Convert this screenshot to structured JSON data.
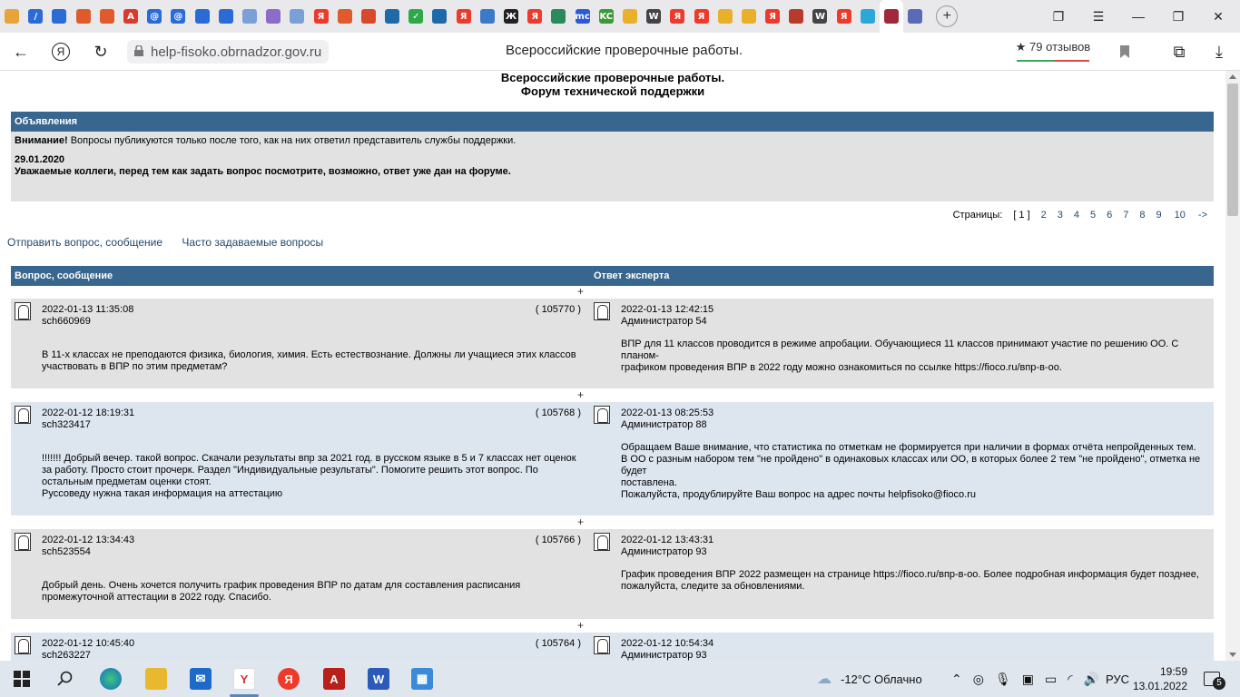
{
  "browser": {
    "tabs": [
      {
        "icon": "mail-icon",
        "color": "#e8a33a"
      },
      {
        "icon": "slash-icon",
        "color": "#2b6bd6"
      },
      {
        "icon": "mail-icon",
        "color": "#2b6bd6"
      },
      {
        "icon": "wheel-icon",
        "color": "#e05a2b"
      },
      {
        "icon": "wheel-icon",
        "color": "#e05a2b"
      },
      {
        "icon": "pdf-icon",
        "color": "#d83b2b"
      },
      {
        "icon": "at-icon",
        "color": "#2b6bd6"
      },
      {
        "icon": "at-icon",
        "color": "#2b6bd6"
      },
      {
        "icon": "mail-x-icon",
        "color": "#2b6bd6"
      },
      {
        "icon": "mail-x-icon",
        "color": "#2b6bd6"
      },
      {
        "icon": "dots-icon",
        "color": "#7aa0d8"
      },
      {
        "icon": "dots-icon",
        "color": "#8c6cc8"
      },
      {
        "icon": "dots-icon",
        "color": "#7aa0d8"
      },
      {
        "icon": "yandex-icon",
        "color": "#ee3a2b"
      },
      {
        "icon": "wheel-icon",
        "color": "#e05a2b"
      },
      {
        "icon": "box-icon",
        "color": "#d8492b"
      },
      {
        "icon": "book-icon",
        "color": "#1e6aa8"
      },
      {
        "icon": "check-icon",
        "color": "#2fa84a"
      },
      {
        "icon": "book-icon",
        "color": "#1e6aa8"
      },
      {
        "icon": "yandex-icon",
        "color": "#ee3a2b"
      },
      {
        "icon": "star-icon",
        "color": "#3a7ac8"
      },
      {
        "icon": "cross-icon",
        "color": "#222222"
      },
      {
        "icon": "yandex-icon",
        "color": "#ee3a2b"
      },
      {
        "icon": "globe-icon",
        "color": "#2b8a5a"
      },
      {
        "icon": "mc-icon",
        "color": "#2b5ad6"
      },
      {
        "icon": "kc-icon",
        "color": "#3a9a3a"
      },
      {
        "icon": "mountain-icon",
        "color": "#e8b02b"
      },
      {
        "icon": "wiki-icon",
        "color": "#444444"
      },
      {
        "icon": "yandex-icon",
        "color": "#ee3a2b"
      },
      {
        "icon": "yandex-icon",
        "color": "#ee3a2b"
      },
      {
        "icon": "mountain-icon",
        "color": "#e8b02b"
      },
      {
        "icon": "mountain-icon",
        "color": "#e8b02b"
      },
      {
        "icon": "yandex-icon",
        "color": "#ee3a2b"
      },
      {
        "icon": "emblem-icon",
        "color": "#b83a2b"
      },
      {
        "icon": "wiki-icon",
        "color": "#444444"
      },
      {
        "icon": "yandex-icon",
        "color": "#ee3a2b"
      },
      {
        "icon": "circle-icon",
        "color": "#2ba8d8"
      },
      {
        "icon": "feather-icon",
        "color": "#a0283a",
        "active": true
      },
      {
        "icon": "bars-icon",
        "color": "#5a6ab8"
      }
    ],
    "url": "help-fisoko.obrnadzor.gov.ru",
    "page_title": "Всероссийские проверочные работы.",
    "reviews": "★ 79 отзывов"
  },
  "site": {
    "title_line1": "Всероссийские проверочные работы.",
    "title_line2": "Форум технической поддержки"
  },
  "announcements": {
    "header": "Объявления",
    "attention_label": "Внимание!",
    "attention_text": " Вопросы публикуются только после того, как на них ответил представитель службы поддержки.",
    "date": "29.01.2020",
    "notice": "Уважаемые коллеги, перед тем как задать вопрос посмотрите, возможно, ответ уже дан на форуме."
  },
  "pagination": {
    "label": "Страницы:",
    "current": "[ 1 ]",
    "pages": [
      "2",
      "3",
      "4",
      "5",
      "6",
      "7",
      "8",
      "9",
      "10",
      "->"
    ]
  },
  "links": {
    "send": "Отправить вопрос, сообщение",
    "faq": "Часто задаваемые вопросы"
  },
  "table": {
    "col_question": "Вопрос, сообщение",
    "col_answer": "Ответ эксперта",
    "plus": "+"
  },
  "posts": [
    {
      "q_date": "2022-01-13 11:35:08",
      "q_user": "sch660969",
      "q_id": "( 105770 )",
      "q_text": [
        "В 11-х классах не преподаются физика, биология, химия. Есть естествознание. Должны ли учащиеся этих классов",
        "участвовать в ВПР по этим предметам?"
      ],
      "a_date": "2022-01-13 12:42:15",
      "a_user": "Администратор 54",
      "a_text": [
        "ВПР для 11 классов проводится в режиме апробации. Обучающиеся 11 классов принимают участие по решению ОО. С планом-",
        "графиком проведения ВПР в 2022 году можно ознакомиться по ссылке https://fioco.ru/впр-в-оо."
      ]
    },
    {
      "q_date": "2022-01-12 18:19:31",
      "q_user": "sch323417",
      "q_id": "( 105768 )",
      "q_text": [
        "!!!!!!! Добрый вечер. такой вопрос. Скачали результаты впр за 2021 год. в русском языке в 5 и 7 классах нет оценок",
        "за работу. Просто стоит прочерк. Раздел \"Индивидуальные результаты\". Помогите решить этот вопрос. По",
        "остальным предметам оценки стоят.",
        "Руссоведу нужна такая информация на аттестацию"
      ],
      "a_date": "2022-01-13 08:25:53",
      "a_user": "Администратор 88",
      "a_text": [
        "Обращаем Ваше внимание, что статистика по отметкам не формируется при наличии в формах отчёта непройденных тем.",
        "В ОО с разным набором тем \"не пройдено\" в одинаковых классах или ОО, в которых более 2 тем \"не пройдено\", отметка не будет",
        "поставлена.",
        "Пожалуйста, продублируйте Ваш вопрос на адрес почты helpfisoko@fioco.ru"
      ]
    },
    {
      "q_date": "2022-01-12 13:34:43",
      "q_user": "sch523554",
      "q_id": "( 105766 )",
      "q_text": [
        "Добрый день. Очень хочется получить график проведения ВПР по датам для составления расписания",
        "промежуточной аттестации в 2022 году. Спасибо."
      ],
      "a_date": "2022-01-12 13:43:31",
      "a_user": "Администратор 93",
      "a_text": [
        "График проведения ВПР 2022 размещен на странице https://fioco.ru/впр-в-оо. Более подробная информация будет позднее,",
        "пожалуйста, следите за обновлениями."
      ]
    },
    {
      "q_date": "2022-01-12 10:45:40",
      "q_user": "sch263227",
      "q_id": "( 105764 )",
      "q_text": [],
      "a_date": "2022-01-12 10:54:34",
      "a_user": "Администратор 93",
      "a_text": []
    }
  ],
  "taskbar": {
    "weather": "-12°C  Облачно",
    "lang": "РУС",
    "time": "19:59",
    "date": "13.01.2022",
    "notifications": "5"
  }
}
